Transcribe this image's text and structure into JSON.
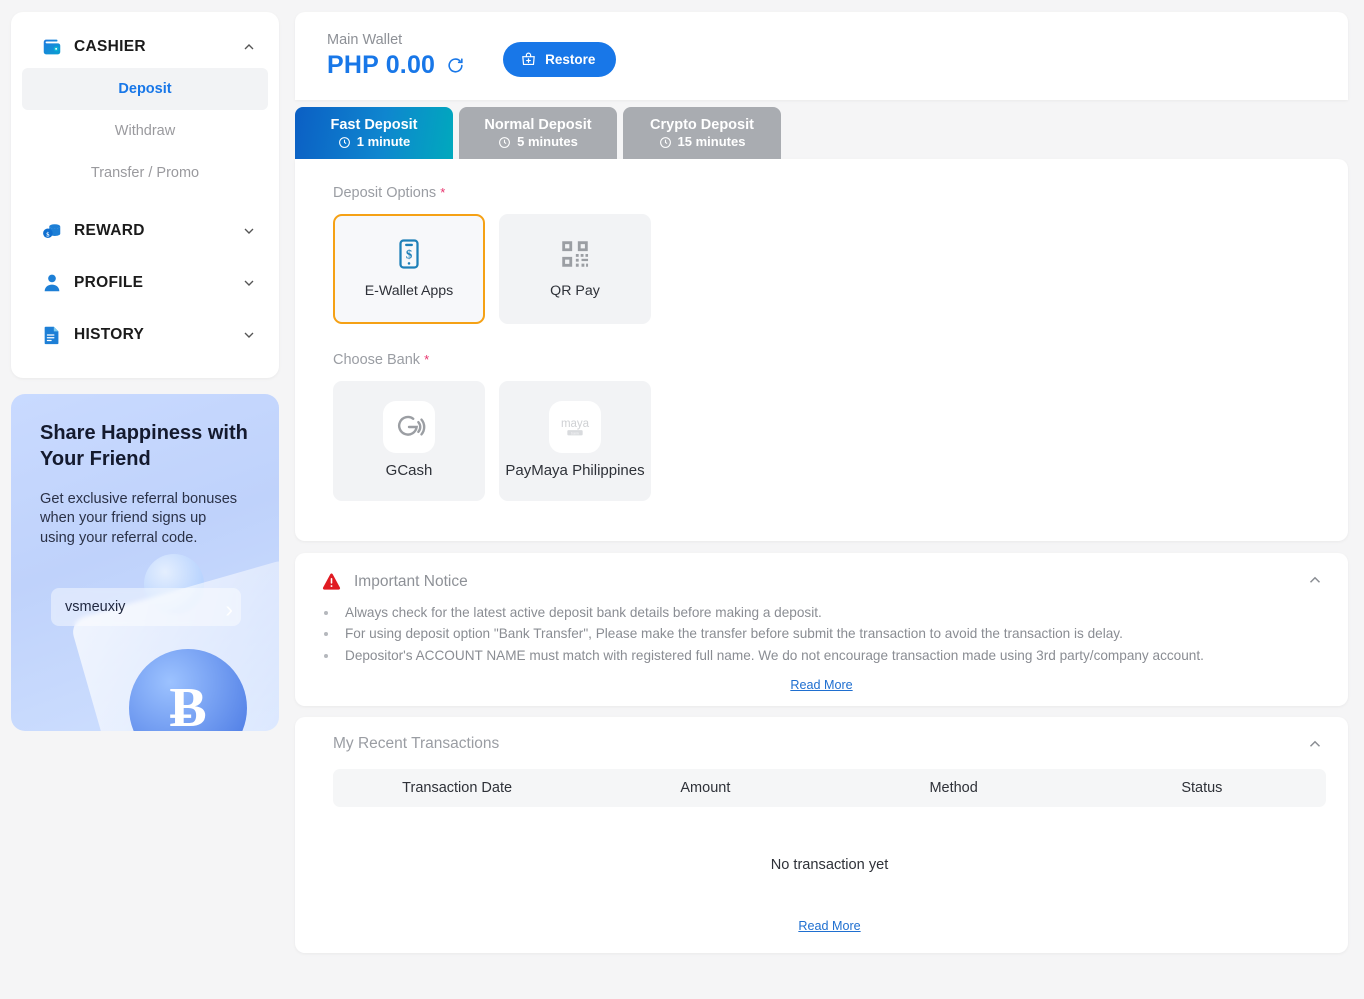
{
  "sidebar": {
    "groups": [
      {
        "label": "CASHIER",
        "icon": "wallet-icon",
        "expanded": true,
        "items": [
          {
            "label": "Deposit",
            "active": true
          },
          {
            "label": "Withdraw",
            "active": false
          },
          {
            "label": "Transfer / Promo",
            "active": false
          }
        ]
      },
      {
        "label": "REWARD",
        "icon": "coins-icon",
        "expanded": false,
        "items": []
      },
      {
        "label": "PROFILE",
        "icon": "person-icon",
        "expanded": false,
        "items": []
      },
      {
        "label": "HISTORY",
        "icon": "document-icon",
        "expanded": false,
        "items": []
      }
    ]
  },
  "promo": {
    "title": "Share Happiness with Your Friend",
    "body": "Get exclusive referral bonuses when your friend signs up using your referral code.",
    "referral_code": "vsmeuxiy",
    "arrow": "›",
    "bitcoin_glyph": "Ƀ"
  },
  "wallet": {
    "label": "Main Wallet",
    "amount": "PHP 0.00",
    "refresh_icon": "refresh-icon",
    "restore_label": "Restore",
    "restore_icon": "restore-bag-icon"
  },
  "tabs": [
    {
      "name": "Fast Deposit",
      "time": "1 minute",
      "active": true
    },
    {
      "name": "Normal Deposit",
      "time": "5 minutes",
      "active": false
    },
    {
      "name": "Crypto Deposit",
      "time": "15 minutes",
      "active": false
    }
  ],
  "deposit": {
    "options_label": "Deposit Options",
    "required_mark": "*",
    "options": [
      {
        "label": "E-Wallet Apps",
        "icon": "phone-dollar-icon",
        "selected": true
      },
      {
        "label": "QR Pay",
        "icon": "qr-code-icon",
        "selected": false
      }
    ],
    "bank_label": "Choose Bank",
    "banks": [
      {
        "label": "GCash",
        "icon": "gcash-logo",
        "selected": false
      },
      {
        "label": "PayMaya Philippines",
        "icon": "paymaya-logo",
        "selected": false
      }
    ]
  },
  "notice": {
    "title": "Important Notice",
    "icon": "warning-triangle-icon",
    "collapse_icon": "chevron-up-icon",
    "items": [
      "Always check for the latest active deposit bank details before making a deposit.",
      "For using deposit option \"Bank Transfer\", Please make the transfer before submit the transaction to avoid the transaction is delay.",
      "Depositor's ACCOUNT NAME must match with registered full name. We do not encourage transaction made using 3rd party/company account."
    ],
    "read_more": "Read More"
  },
  "transactions": {
    "title": "My Recent Transactions",
    "collapse_icon": "chevron-up-icon",
    "columns": [
      "Transaction Date",
      "Amount",
      "Method",
      "Status"
    ],
    "empty_text": "No transaction yet",
    "rows": [],
    "read_more": "Read More"
  },
  "colors": {
    "accent_blue": "#1877e8",
    "tab_gradient_start": "#0b5fc4",
    "tab_gradient_end": "#00a9bd",
    "selected_border": "#f5a115",
    "required_red": "#e8336d",
    "warning_red": "#e01b22",
    "muted_text": "#9a9da3"
  }
}
